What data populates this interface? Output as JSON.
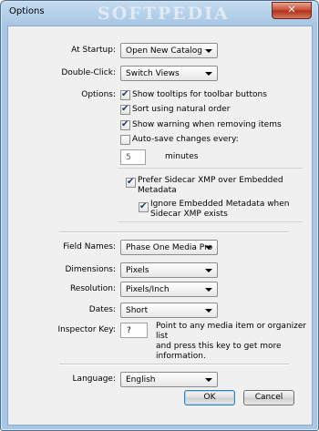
{
  "window": {
    "title": "Options",
    "watermark": "SOFTPEDIA",
    "close_label": "✕"
  },
  "startup": {
    "label": "At Startup:",
    "value": "Open New Catalog"
  },
  "double_click": {
    "label": "Double-Click:",
    "value": "Switch Views"
  },
  "options": {
    "label": "Options:",
    "show_tooltips": {
      "label": "Show tooltips for toolbar buttons",
      "checked": true
    },
    "natural_order": {
      "label": "Sort using natural order",
      "checked": true
    },
    "show_warning": {
      "label": "Show warning when removing items",
      "checked": true
    },
    "auto_save": {
      "label": "Auto-save changes every:",
      "checked": false
    },
    "minutes_value": "5",
    "minutes_label": "minutes"
  },
  "metadata": {
    "prefer_xmp_line1": "Prefer Sidecar XMP over Embedded",
    "prefer_xmp_line2": "Metadata",
    "ignore_embedded_line1": "Ignore Embedded Metadata when",
    "ignore_embedded_line2": "Sidecar XMP exists",
    "prefer_xmp_checked": true,
    "ignore_embedded_checked": true
  },
  "field_names": {
    "label": "Field Names:",
    "value": "Phase One Media Pro"
  },
  "dimensions": {
    "label": "Dimensions:",
    "value": "Pixels"
  },
  "resolution": {
    "label": "Resolution:",
    "value": "Pixels/Inch"
  },
  "dates": {
    "label": "Dates:",
    "value": "Short"
  },
  "inspector": {
    "label": "Inspector Key:",
    "value": "?",
    "help_line1": "Point to any media item or organizer list",
    "help_line2": "and press this key to get more",
    "help_line3": "information."
  },
  "language": {
    "label": "Language:",
    "value": "English"
  },
  "buttons": {
    "ok": "OK",
    "cancel": "Cancel"
  }
}
